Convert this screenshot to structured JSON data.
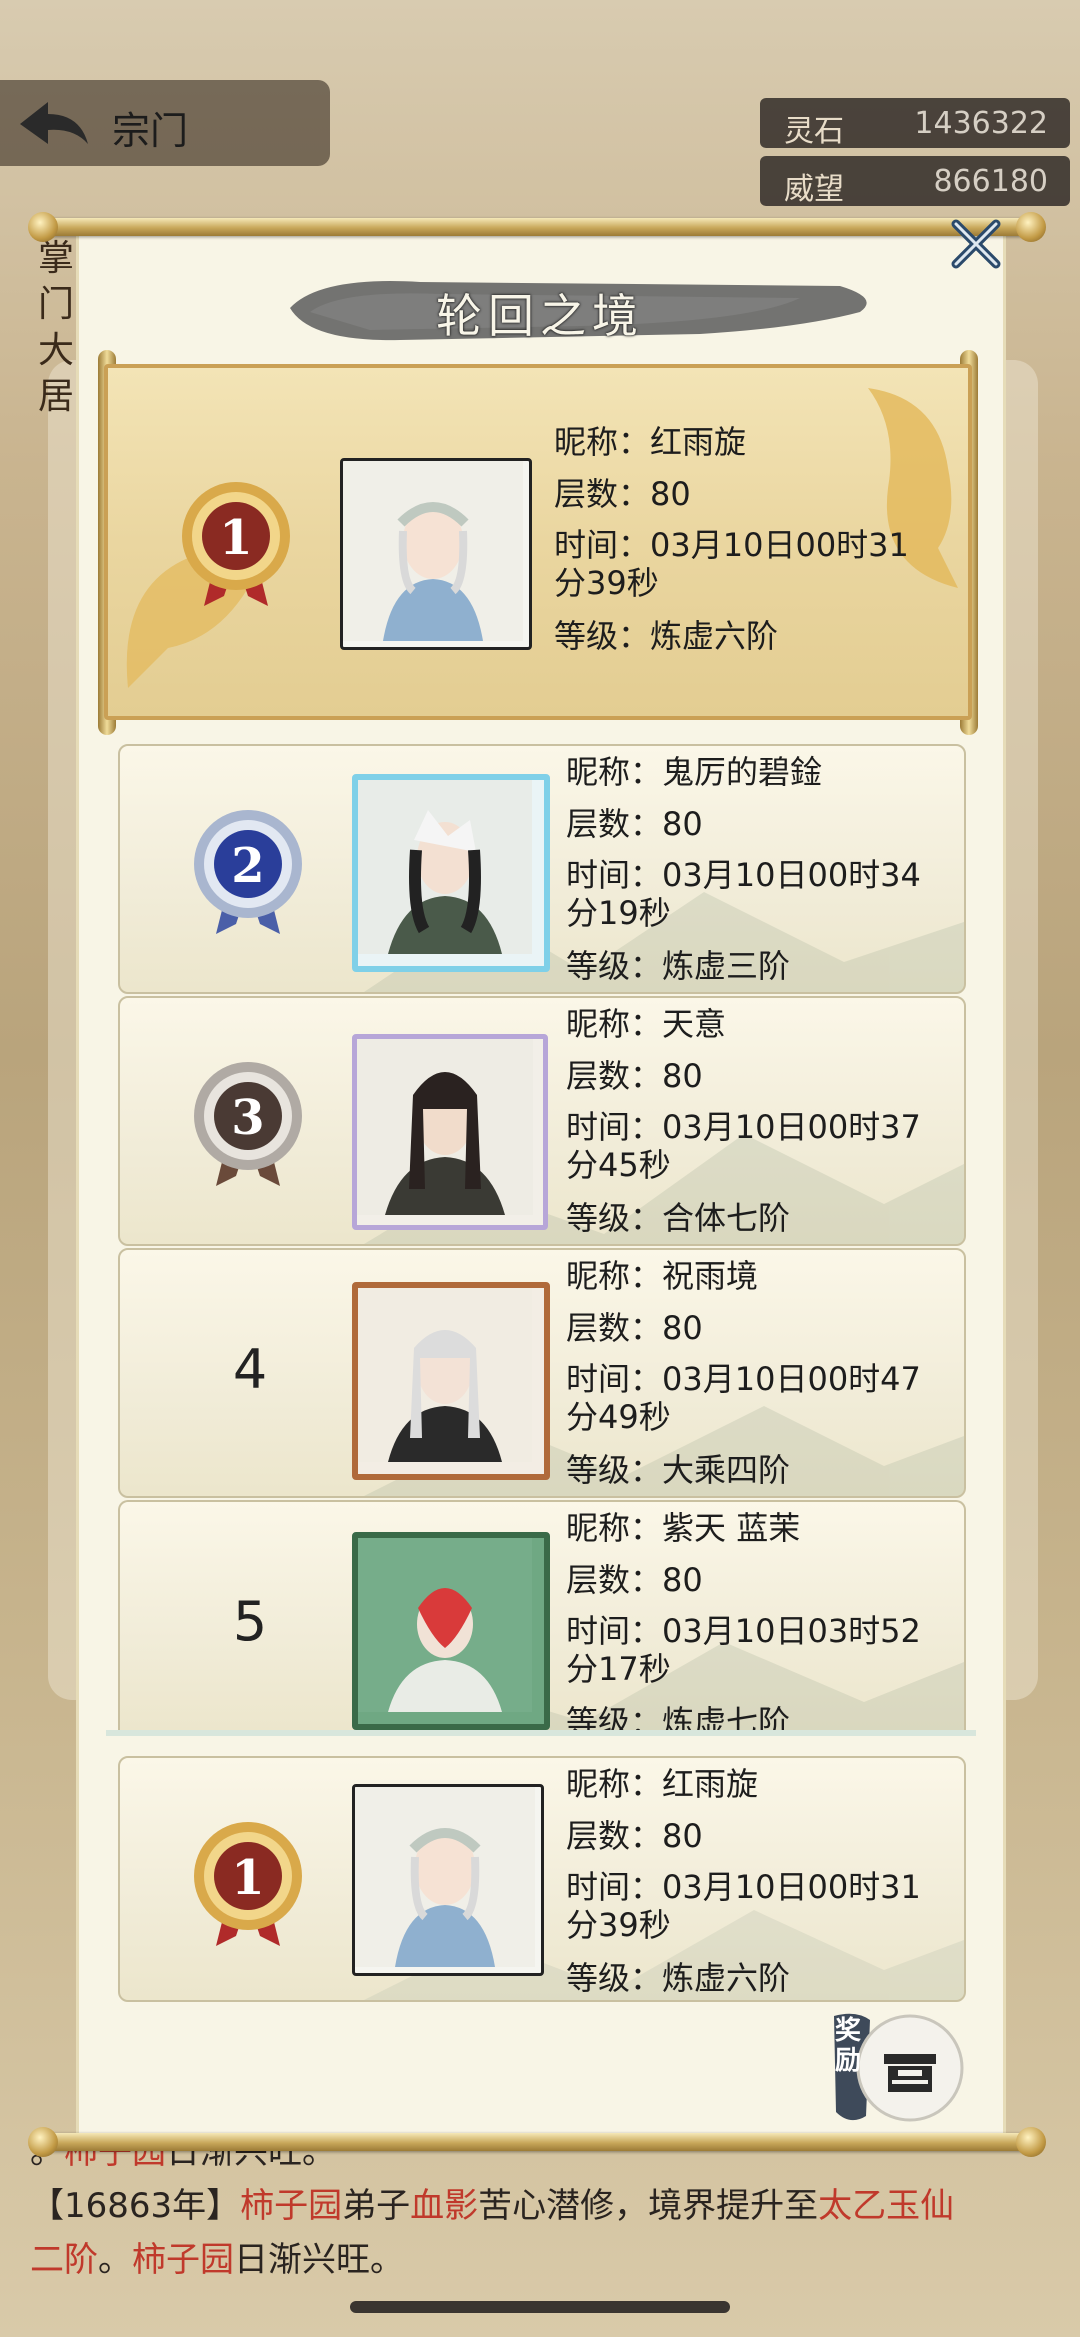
{
  "background": {
    "title": "宗门",
    "resources": [
      {
        "label": "灵石",
        "value": "1436322"
      },
      {
        "label": "威望",
        "value": "866180"
      }
    ],
    "side_text": "掌门大居",
    "log_line1_prefix": "。",
    "log_line1_name": "柿子园",
    "log_line1_rest": "日渐兴旺。",
    "log_line2_year": "【16863年】",
    "log_line2_sect": "柿子园",
    "log_line2_mid": "弟子",
    "log_line2_person": "血影",
    "log_line2_rest": "苦心潜修，境界提升至",
    "log_line2_realm": "太乙玉仙",
    "log_line3_realm": "二阶",
    "log_line3_sep": "。",
    "log_line3_name": "柿子园",
    "log_line3_rest": "日渐兴旺。"
  },
  "modal": {
    "title": "轮回之境",
    "reward_label": "奖励"
  },
  "labels": {
    "nickname": "昵称：",
    "floors": "层数：",
    "time": "时间：",
    "level": "等级："
  },
  "entries": [
    {
      "rank": "1",
      "nickname": "红雨旋",
      "floors": "80",
      "time_a": "03月10日00时31",
      "time_b": "分39秒",
      "level": "炼虚六阶"
    },
    {
      "rank": "2",
      "nickname": "鬼厉的碧鍂",
      "floors": "80",
      "time_a": "03月10日00时34",
      "time_b": "分19秒",
      "level": "炼虚三阶"
    },
    {
      "rank": "3",
      "nickname": "天意",
      "floors": "80",
      "time_a": "03月10日00时37",
      "time_b": "分45秒",
      "level": "合体七阶"
    },
    {
      "rank": "4",
      "nickname": "祝雨境",
      "floors": "80",
      "time_a": "03月10日00时47",
      "time_b": "分49秒",
      "level": "大乘四阶"
    },
    {
      "rank": "5",
      "nickname": "紫天 蓝茉",
      "floors": "80",
      "time_a": "03月10日03时52",
      "time_b": "分17秒",
      "level": "炼虚七阶"
    }
  ],
  "my_entry": {
    "rank": "1",
    "nickname": "红雨旋",
    "floors": "80",
    "time_a": "03月10日00时31",
    "time_b": "分39秒",
    "level": "炼虚六阶"
  },
  "colors": {
    "gold": "#c9a24f",
    "red_text": "#c0392b",
    "panel": "#f8f5e6"
  }
}
